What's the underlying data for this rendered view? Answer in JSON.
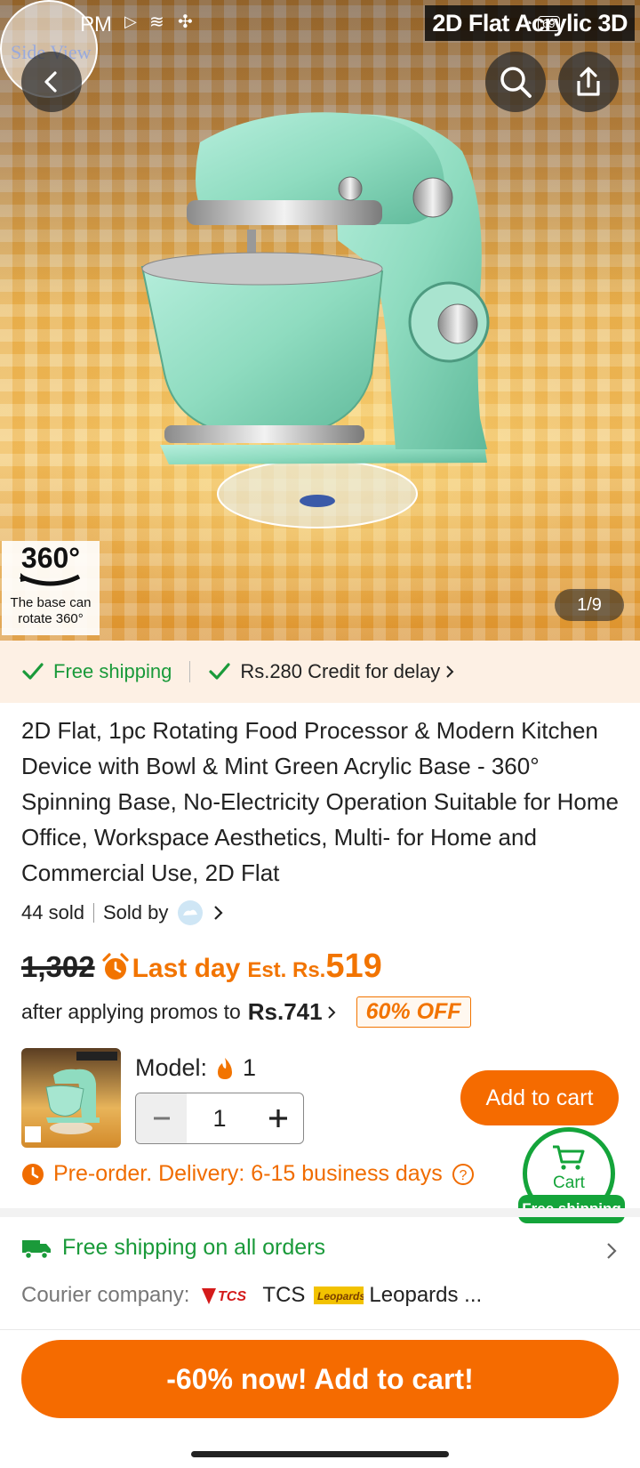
{
  "status_bar": {
    "time": "PM"
  },
  "overlay": {
    "banner_text": "2D Flat Acrylic 3D",
    "side_view": "Side View"
  },
  "badge_360": {
    "degrees": "360°",
    "caption_line1": "The base can",
    "caption_line2": "rotate 360°"
  },
  "gallery": {
    "counter": "1/9",
    "current": 1,
    "total": 9
  },
  "shipping_bar": {
    "free_shipping": "Free shipping",
    "credit": "Rs.280 Credit for delay"
  },
  "product": {
    "title": "2D Flat, 1pc Rotating Food Processor & Modern Kitchen Device with Bowl & Mint Green Acrylic Base - 360° Spinning Base, No-Electricity Operation Suitable for Home Office, Workspace Aesthetics, Multi- for Home and Commercial Use, 2D Flat",
    "sold_count": "44 sold",
    "sold_by": "Sold by"
  },
  "price": {
    "original": "1,302",
    "last_day": "Last day",
    "est_label": "Est. Rs.",
    "est_value": "519",
    "after_promos": "after applying promos to",
    "promo_price": "Rs.741",
    "discount": "60% OFF"
  },
  "model": {
    "label": "Model:",
    "count": "1",
    "quantity": "1"
  },
  "buttons": {
    "add_to_cart": "Add to cart",
    "cart": "Cart",
    "cart_free_shipping": "Free shipping",
    "main_cta": "-60% now! Add to cart!"
  },
  "preorder": {
    "text": "Pre-order. Delivery: 6-15 business days"
  },
  "delivery": {
    "free_all": "Free shipping on all orders",
    "courier_label": "Courier company:",
    "courier1": "TCS",
    "courier2": "Leopards ..."
  },
  "colors": {
    "orange": "#f56b00",
    "green": "#14a43a",
    "mint": "#8fdcc0"
  }
}
